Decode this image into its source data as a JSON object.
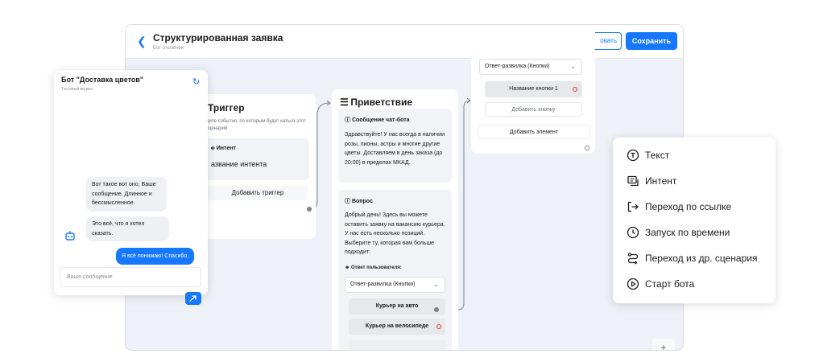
{
  "editor": {
    "title": "Структурированная заявка",
    "subtitle": "Бот отключен",
    "publish_label_partial": "овать",
    "save_label": "Сохранить"
  },
  "trigger_node": {
    "title": "Триггер",
    "description_partial": "дите события, по которым будет каться этот сценарий",
    "intent_label": "Интент",
    "intent_value_partial": "азвание интента",
    "add_trigger_label": "Добавить триггер"
  },
  "greeting_node": {
    "title": "Приветствие",
    "message_block": {
      "title": "Сообщение чат-бота",
      "text": "Здравствуйте! У нас всегда в наличии розы, пионы, астры и многие другие цветы. Доставляем в день заказа (до 20:00) в пределах МКАД."
    },
    "question_block": {
      "title": "Вопрос",
      "text": "Добрый день! Здесь вы можете оставить заявку на вакансию курьера. У нас есть несколько позиций. Выберите ту, которая вам больше подходит:",
      "user_answer_label": "Ответ пользователя:",
      "answer_type": "Ответ-развилка (Кнопки)",
      "choices": [
        "Курьер на авто",
        "Курьер на велосипеде"
      ]
    }
  },
  "partial_node": {
    "answer_type": "Ответ-развилка (Кнопки)",
    "button_name": "Название кнопки 1",
    "add_button_label": "Добавить кнопку",
    "add_element_label": "Добавить элемент"
  },
  "zoom": {
    "in": "+",
    "out": "−"
  },
  "chat": {
    "title": "Бот \"Доставка цветов\"",
    "subtitle": "Тестовый виджет",
    "messages": [
      {
        "from": "bot",
        "text": "Вот такое вот оно, Ваше сообщение. Длинное и бессмысленное."
      },
      {
        "from": "bot",
        "text": "Это всё, что я хотел сказать."
      },
      {
        "from": "user",
        "text": "Я всё понимаю! Спасибо."
      }
    ],
    "input_placeholder": "Ваше сообщение"
  },
  "menu": {
    "items": [
      {
        "label": "Текст",
        "icon": "text-icon"
      },
      {
        "label": "Интент",
        "icon": "intent-icon"
      },
      {
        "label": "Переход по ссылке",
        "icon": "link-exit-icon"
      },
      {
        "label": "Запуск по времени",
        "icon": "clock-icon"
      },
      {
        "label": "Переход из др. сценария",
        "icon": "route-icon"
      },
      {
        "label": "Старт бота",
        "icon": "play-icon"
      }
    ]
  },
  "colors": {
    "accent": "#1677ff",
    "canvas": "#eef1f7",
    "alert": "#e53935"
  }
}
